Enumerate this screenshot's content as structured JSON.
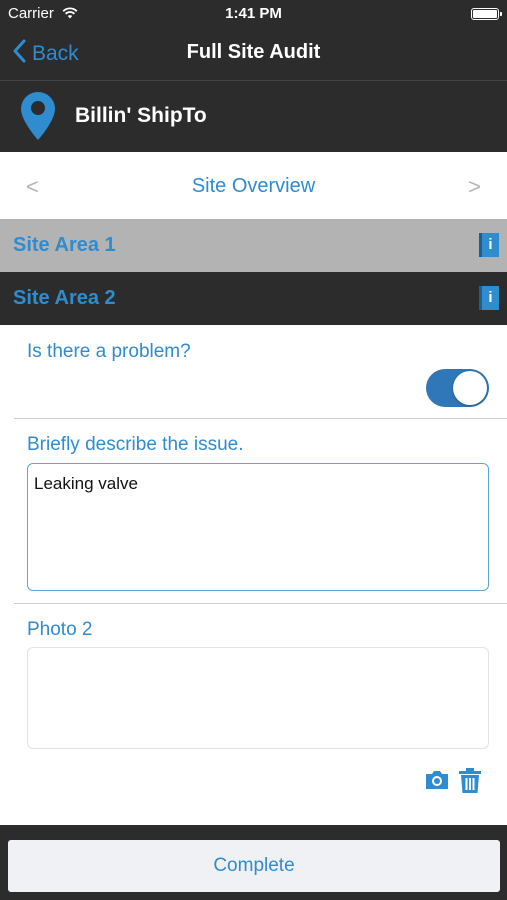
{
  "status_bar": {
    "carrier": "Carrier",
    "time": "1:41 PM"
  },
  "nav": {
    "back_label": "Back",
    "title": "Full Site Audit"
  },
  "location": {
    "name": "Billin' ShipTo",
    "icon": "map-pin-icon"
  },
  "section": {
    "prev_label": "<",
    "title": "Site Overview",
    "next_label": ">"
  },
  "areas": [
    {
      "label": "Site Area 1",
      "info_label": "i"
    },
    {
      "label": "Site Area 2",
      "info_label": "i"
    }
  ],
  "form": {
    "question_problem": "Is there a problem?",
    "problem_toggle_on": true,
    "question_describe": "Briefly describe the issue.",
    "describe_value": "Leaking valve",
    "photo_label": "Photo 2"
  },
  "footer": {
    "complete_label": "Complete"
  },
  "colors": {
    "accent": "#2f8ccf",
    "dark_bg": "#2c2c2c",
    "selected_row_bg": "#b3b3b3",
    "toggle_on": "#2f77b8"
  }
}
